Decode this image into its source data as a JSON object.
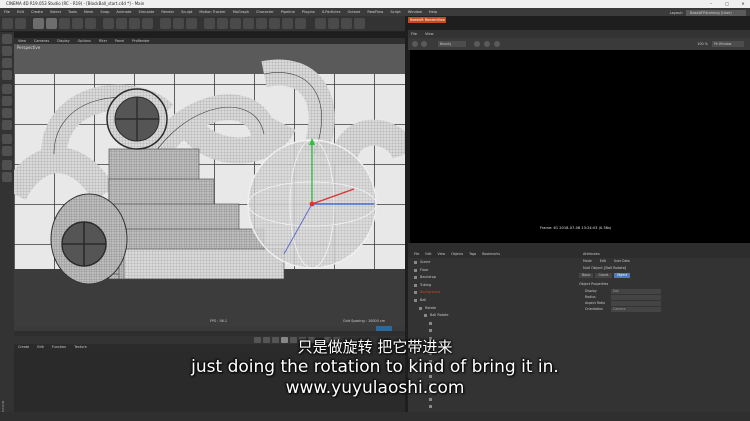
{
  "window": {
    "title": "CINEMA 4D R19.053 Studio (RC - R19) - [BlockBall_start.c4d *] - Main",
    "controls": [
      "–",
      "□",
      "✕"
    ]
  },
  "menubar": {
    "items": [
      "File",
      "Edit",
      "Create",
      "Select",
      "Tools",
      "Mesh",
      "Snap",
      "Animate",
      "Simulate",
      "Render",
      "Sculpt",
      "Motion Tracker",
      "MoGraph",
      "Character",
      "Pipeline",
      "Plugins",
      "X-Particles",
      "Octane",
      "RealFlow",
      "Script",
      "Window",
      "Help"
    ],
    "layout_label": "Layout:",
    "layout_value": "BaseAFRtraining (User)"
  },
  "viewport": {
    "menu": [
      "View",
      "Cameras",
      "Display",
      "Options",
      "Filter",
      "Panel",
      "ProRender"
    ],
    "label": "Perspective",
    "fps": "FPS : 56.1",
    "grid_spacing": "Grid Spacing : 10000 cm"
  },
  "material_manager": {
    "menu": [
      "Create",
      "Edit",
      "Function",
      "Texture"
    ]
  },
  "render_view": {
    "tab": "Redshift RenderView",
    "menu": [
      "File",
      "View"
    ],
    "beauty_select": "Beauty",
    "zoom": "100 %",
    "fit_select": "Fit Window",
    "frame_info": "Frame: 61  2018-07-06  13:24:03  (0.36s)"
  },
  "object_manager": {
    "menu": [
      "File",
      "Edit",
      "View",
      "Objects",
      "Tags",
      "Bookmarks"
    ],
    "objects": [
      {
        "name": "Scene",
        "indent": 0
      },
      {
        "name": "Floor",
        "indent": 0
      },
      {
        "name": "Backdrop",
        "indent": 0
      },
      {
        "name": "Tubing",
        "indent": 0
      },
      {
        "name": "Background",
        "indent": 0
      },
      {
        "name": "Ball",
        "indent": 0
      },
      {
        "name": "Rotate",
        "indent": 1
      },
      {
        "name": "Ball Rotate",
        "indent": 2
      },
      {
        "name": "",
        "indent": 3
      },
      {
        "name": "",
        "indent": 3
      },
      {
        "name": "",
        "indent": 3
      },
      {
        "name": "",
        "indent": 3
      },
      {
        "name": "",
        "indent": 3
      },
      {
        "name": "",
        "indent": 3
      },
      {
        "name": "",
        "indent": 3
      },
      {
        "name": "",
        "indent": 3
      },
      {
        "name": "",
        "indent": 3
      },
      {
        "name": "",
        "indent": 3
      },
      {
        "name": "",
        "indent": 3
      },
      {
        "name": "",
        "indent": 3
      }
    ]
  },
  "attributes": {
    "title": "Attributes",
    "menu": [
      "Mode",
      "Edit",
      "User Data"
    ],
    "object_name": "Null Object [Ball Rotate]",
    "tabs": [
      "Basic",
      "Coord.",
      "Object"
    ],
    "active_tab": "Object",
    "section": "Object Properties",
    "rows": [
      {
        "label": "Display",
        "value": "Dot"
      },
      {
        "label": "Radius",
        "value": ""
      },
      {
        "label": "Aspect Ratio",
        "value": ""
      },
      {
        "label": "Orientation",
        "value": "Camera"
      }
    ]
  },
  "subtitles": {
    "zh": "只是做旋转 把它带进来",
    "en": "just doing the rotation to kind of bring it in.",
    "url": "www.yuyulaoshi.com"
  },
  "colors": {
    "accent_orange": "#c44b1e",
    "selection_blue": "#4f7ab3",
    "axis_x": "#e03030",
    "axis_y": "#30c040",
    "axis_z": "#3060e0"
  }
}
